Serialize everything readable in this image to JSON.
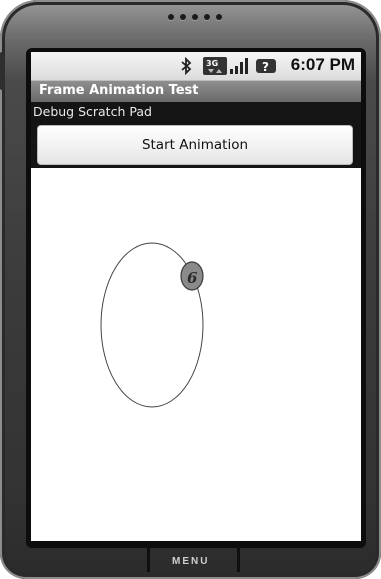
{
  "app": {
    "title": "Frame Animation Test",
    "debug_label": "Debug Scratch Pad"
  },
  "status_bar": {
    "time": "6:07 PM",
    "icons": [
      "bluetooth-icon",
      "3g-network-icon",
      "signal-strength-icon",
      "notification-alert-icon"
    ],
    "network_badge": "3G"
  },
  "controls": {
    "start_button_label": "Start Animation"
  },
  "device": {
    "menu_label": "MENU"
  },
  "colors": {
    "title_bar": "#7a7a7a",
    "status_bar": "#e6e6e6",
    "canvas": "#ffffff",
    "sprite": "#8a8a8a",
    "path": "#444444"
  },
  "animation": {
    "sprite_glyph": "6",
    "path_shape": "ellipse"
  }
}
